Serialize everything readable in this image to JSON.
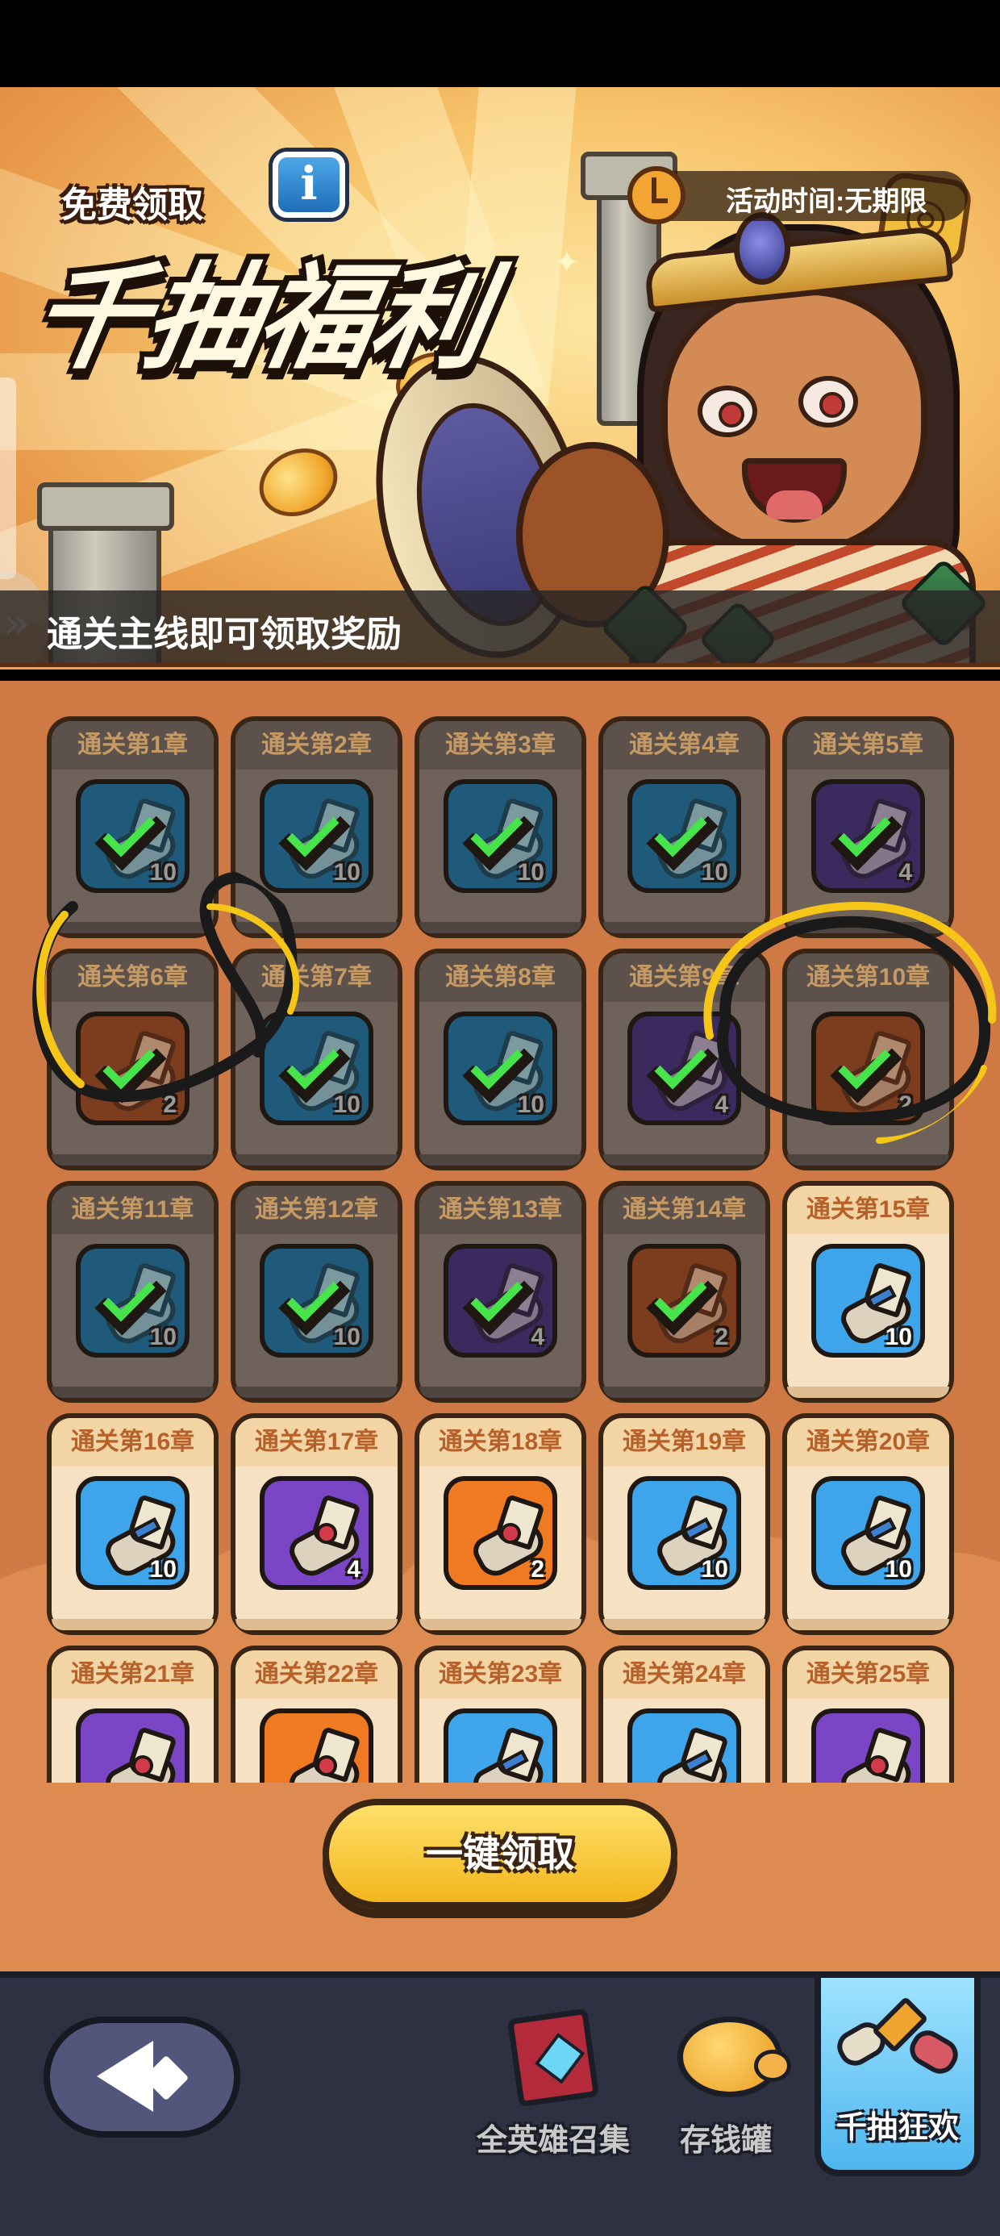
{
  "banner": {
    "free_label": "免费领取",
    "info_icon": "info-icon",
    "title": "千抽福利",
    "activity_time": "活动时间:无期限",
    "subtitle": "通关主线即可领取奖励"
  },
  "rewards": {
    "items": [
      {
        "chapter": "通关第1章",
        "color": "blue",
        "count": "10",
        "claimed": true
      },
      {
        "chapter": "通关第2章",
        "color": "blue",
        "count": "10",
        "claimed": true
      },
      {
        "chapter": "通关第3章",
        "color": "blue",
        "count": "10",
        "claimed": true
      },
      {
        "chapter": "通关第4章",
        "color": "blue",
        "count": "10",
        "claimed": true
      },
      {
        "chapter": "通关第5章",
        "color": "purple",
        "count": "4",
        "claimed": true
      },
      {
        "chapter": "通关第6章",
        "color": "orange",
        "count": "2",
        "claimed": true
      },
      {
        "chapter": "通关第7章",
        "color": "blue",
        "count": "10",
        "claimed": true
      },
      {
        "chapter": "通关第8章",
        "color": "blue",
        "count": "10",
        "claimed": true
      },
      {
        "chapter": "通关第9章",
        "color": "purple",
        "count": "4",
        "claimed": true
      },
      {
        "chapter": "通关第10章",
        "color": "orange",
        "count": "2",
        "claimed": true
      },
      {
        "chapter": "通关第11章",
        "color": "blue",
        "count": "10",
        "claimed": true
      },
      {
        "chapter": "通关第12章",
        "color": "blue",
        "count": "10",
        "claimed": true
      },
      {
        "chapter": "通关第13章",
        "color": "purple",
        "count": "4",
        "claimed": true
      },
      {
        "chapter": "通关第14章",
        "color": "orange",
        "count": "2",
        "claimed": true
      },
      {
        "chapter": "通关第15章",
        "color": "blue",
        "count": "10",
        "claimed": false
      },
      {
        "chapter": "通关第16章",
        "color": "blue",
        "count": "10",
        "claimed": false
      },
      {
        "chapter": "通关第17章",
        "color": "purple",
        "count": "4",
        "claimed": false
      },
      {
        "chapter": "通关第18章",
        "color": "orange",
        "count": "2",
        "claimed": false
      },
      {
        "chapter": "通关第19章",
        "color": "blue",
        "count": "10",
        "claimed": false
      },
      {
        "chapter": "通关第20章",
        "color": "blue",
        "count": "10",
        "claimed": false
      },
      {
        "chapter": "通关第21章",
        "color": "purple",
        "count": "",
        "claimed": false
      },
      {
        "chapter": "通关第22章",
        "color": "orange",
        "count": "",
        "claimed": false
      },
      {
        "chapter": "通关第23章",
        "color": "blue",
        "count": "",
        "claimed": false
      },
      {
        "chapter": "通关第24章",
        "color": "blue",
        "count": "",
        "claimed": false
      },
      {
        "chapter": "通关第25章",
        "color": "purple",
        "count": "",
        "claimed": false
      }
    ]
  },
  "claim_all_label": "一键领取",
  "bottom_nav": {
    "back_icon": "back-arrow-icon",
    "items": [
      {
        "label": "全英雄召集",
        "icon": "spellbook-icon"
      },
      {
        "label": "存钱罐",
        "icon": "piggy-bank-icon"
      },
      {
        "label": "千抽狂欢",
        "icon": "scrolls-icon"
      }
    ]
  },
  "colors": {
    "accent_yellow": "#f2b61c",
    "check_green": "#46e34a",
    "annotation_yellow": "#f5c518"
  }
}
